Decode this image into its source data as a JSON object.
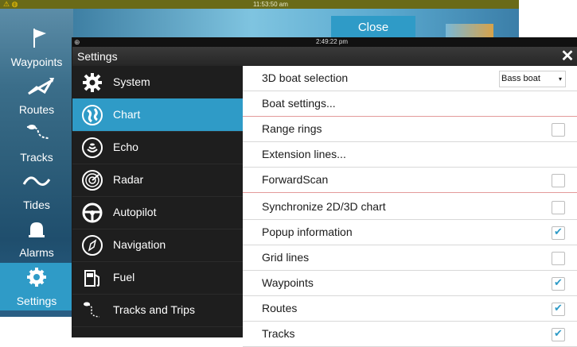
{
  "bg": {
    "status_time": "11:53:50 am",
    "warning_icon": "warning-icon",
    "close_button": "Close",
    "nav": [
      {
        "label": "Waypoints",
        "icon": "flag-icon"
      },
      {
        "label": "Routes",
        "icon": "routes-icon"
      },
      {
        "label": "Tracks",
        "icon": "tracks-icon"
      },
      {
        "label": "Tides",
        "icon": "tide-wave-icon"
      },
      {
        "label": "Alarms",
        "icon": "bell-icon"
      },
      {
        "label": "Settings",
        "icon": "gear-icon"
      }
    ]
  },
  "dialog": {
    "status_time": "2:49:22 pm",
    "title": "Settings",
    "close_icon": "close-icon",
    "categories": [
      {
        "label": "System",
        "icon": "gear-icon",
        "selected": false
      },
      {
        "label": "Chart",
        "icon": "chart-globe-icon",
        "selected": true
      },
      {
        "label": "Echo",
        "icon": "echo-icon",
        "selected": false
      },
      {
        "label": "Radar",
        "icon": "radar-icon",
        "selected": false
      },
      {
        "label": "Autopilot",
        "icon": "steering-wheel-icon",
        "selected": false
      },
      {
        "label": "Navigation",
        "icon": "compass-icon",
        "selected": false
      },
      {
        "label": "Fuel",
        "icon": "fuel-pump-icon",
        "selected": false
      },
      {
        "label": "Tracks and Trips",
        "icon": "tracks-icon",
        "selected": false
      }
    ],
    "options": {
      "boat_selection": {
        "label": "3D boat selection",
        "value": "Bass boat"
      },
      "boat_settings": "Boat settings...",
      "range_rings": {
        "label": "Range rings",
        "checked": false
      },
      "extension_lines": "Extension lines...",
      "forwardscan": {
        "label": "ForwardScan",
        "checked": false
      },
      "sync": {
        "label": "Synchronize 2D/3D chart",
        "checked": false
      },
      "popup": {
        "label": "Popup information",
        "checked": true
      },
      "grid": {
        "label": "Grid lines",
        "checked": false
      },
      "waypoints": {
        "label": "Waypoints",
        "checked": true
      },
      "routes": {
        "label": "Routes",
        "checked": true
      },
      "tracks": {
        "label": "Tracks",
        "checked": true
      }
    }
  },
  "colors": {
    "accent": "#2f9bc7",
    "dialog_dark": "#1e1e1e",
    "title_bar": "#2f2f2f",
    "check": "#2f9bc7"
  }
}
